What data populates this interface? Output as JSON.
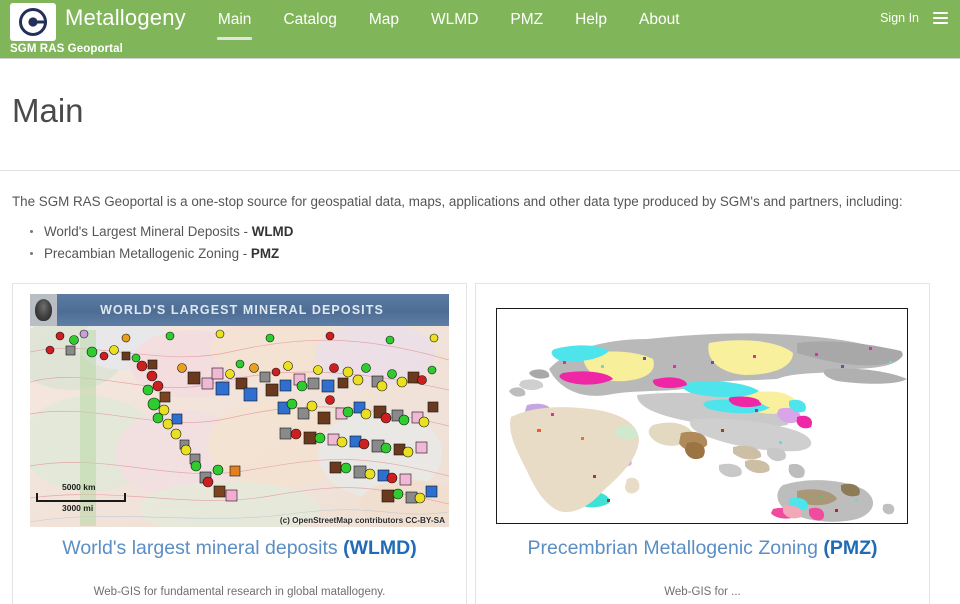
{
  "header": {
    "logo_icon": "geoportal-g-logo-icon",
    "brand_name": "Metallogeny",
    "brand_subtitle": "SGM RAS Geoportal",
    "accent_color": "#81b55a",
    "nav": [
      {
        "label": "Main",
        "active": true
      },
      {
        "label": "Catalog",
        "active": false
      },
      {
        "label": "Map",
        "active": false
      },
      {
        "label": "WLMD",
        "active": false
      },
      {
        "label": "PMZ",
        "active": false
      },
      {
        "label": "Help",
        "active": false
      },
      {
        "label": "About",
        "active": false
      }
    ],
    "sign_in_label": "Sign In",
    "menu_icon": "hamburger-menu-icon"
  },
  "page": {
    "title": "Main"
  },
  "intro": {
    "lead": "The SGM RAS Geoportal is a one-stop source for geospatial data, maps, applications and other data type produced by SGM's and partners, including:",
    "bullets": [
      {
        "text": "World's Largest Mineral Deposits - ",
        "code": "WLMD"
      },
      {
        "text": "Precambian Metallogenic Zoning - ",
        "code": "PMZ"
      }
    ]
  },
  "cards": [
    {
      "name": "wlmd",
      "title_text": "World's largest mineral deposits ",
      "title_code": "(WLMD)",
      "description": "Web-GIS for fundamental research in global matallogeny.",
      "thumb": {
        "banner_title": "WORLD'S LARGEST MINERAL DEPOSITS",
        "scale_km": "5000 km",
        "scale_mi": "3000 mi",
        "attribution": "(c) OpenStreetMap contributors CC-BY-SA"
      },
      "title_color": "#5b8ec4",
      "code_color": "#1f6bb5"
    },
    {
      "name": "pmz",
      "title_text": "Precembrian Metallogenic Zoning ",
      "title_code": "(PMZ)",
      "description": "Web-GIS for ...",
      "thumb": {
        "map_caption": "",
        "banner_title": "",
        "scale_km": "",
        "scale_mi": "",
        "attribution": ""
      },
      "title_color": "#5b8ec4",
      "code_color": "#1f6bb5"
    }
  ]
}
